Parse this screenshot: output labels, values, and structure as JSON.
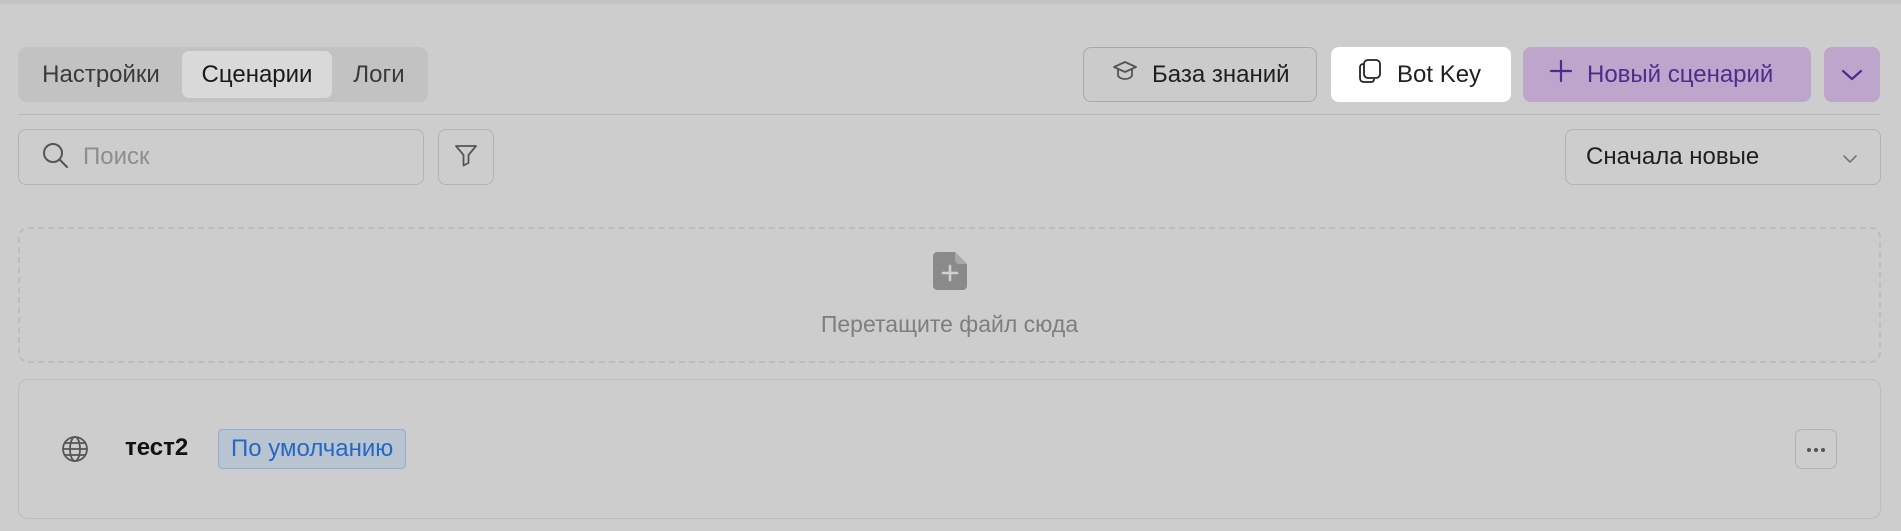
{
  "tabs": [
    {
      "label": "Настройки",
      "active": false
    },
    {
      "label": "Сценарии",
      "active": true
    },
    {
      "label": "Логи",
      "active": false
    }
  ],
  "toolbar": {
    "knowledge_base_label": "База знаний",
    "bot_key_label": "Bot Key",
    "new_scenario_label": "Новый сценарий",
    "knowledge_base_icon": "graduation-cap-icon",
    "bot_key_icon": "copy-icon",
    "new_scenario_icon": "plus-icon",
    "dropdown_icon": "chevron-down-icon"
  },
  "search": {
    "placeholder": "Поиск",
    "value": ""
  },
  "sort": {
    "selected": "Сначала новые"
  },
  "dropzone": {
    "text": "Перетащите файл сюда",
    "icon": "file-add-icon"
  },
  "scenarios": [
    {
      "name": "тест2",
      "badge": "По умолчанию",
      "icon": "globe-icon"
    }
  ],
  "colors": {
    "background": "#cdcdcd",
    "accent": "#bda5cc",
    "accent_text": "#4b2d8c",
    "badge_text": "#2568c6"
  }
}
